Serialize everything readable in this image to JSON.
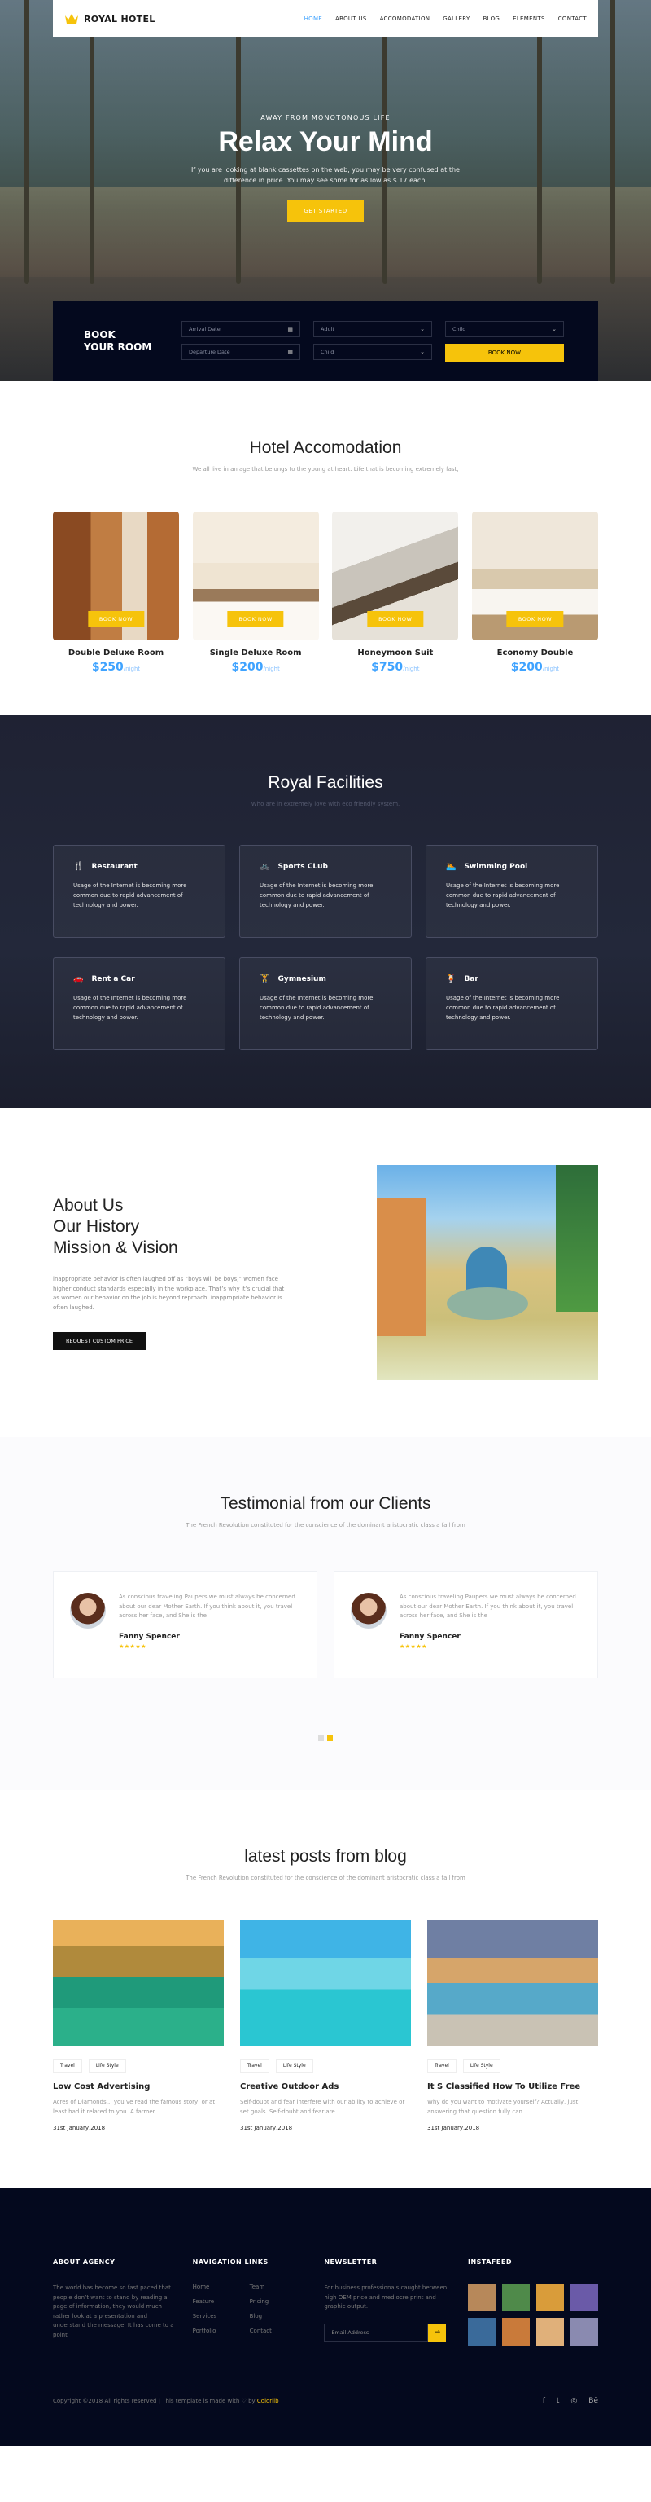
{
  "header": {
    "brand": "ROYAL HOTEL",
    "menu": [
      "HOME",
      "ABOUT US",
      "ACCOMODATION",
      "GALLERY",
      "BLOG",
      "ELEMENTS",
      "CONTACT"
    ]
  },
  "hero": {
    "kicker": "AWAY FROM MONOTONOUS LIFE",
    "title": "Relax Your Mind",
    "text": "If you are looking at blank cassettes on the web, you may be very confused at the difference in price. You may see some for as low as $.17 each.",
    "cta": "GET STARTED"
  },
  "booking": {
    "title_line1": "BOOK",
    "title_line2": "YOUR ROOM",
    "arrival": "Arrival Date",
    "departure": "Departure Date",
    "adult": "Adult",
    "child1": "Child",
    "child2": "Child",
    "submit": "BOOK NOW"
  },
  "accomodation": {
    "title": "Hotel Accomodation",
    "subtitle": "We all live in an age that belongs to the young at heart. Life that is becoming extremely fast,",
    "book_label": "BOOK NOW",
    "per": "/night",
    "rooms": [
      {
        "name": "Double Deluxe Room",
        "price": "$250"
      },
      {
        "name": "Single Deluxe Room",
        "price": "$200"
      },
      {
        "name": "Honeymoon Suit",
        "price": "$750"
      },
      {
        "name": "Economy Double",
        "price": "$200"
      }
    ]
  },
  "facilities": {
    "title": "Royal Facilities",
    "subtitle": "Who are in extremely love with eco friendly system.",
    "items": [
      {
        "icon": "fork-knife-icon",
        "glyph": "🍴",
        "name": "Restaurant",
        "text": "Usage of the Internet is becoming more common due to rapid advancement of technology and power."
      },
      {
        "icon": "bicycle-icon",
        "glyph": "🚲",
        "name": "Sports CLub",
        "text": "Usage of the Internet is becoming more common due to rapid advancement of technology and power."
      },
      {
        "icon": "pool-icon",
        "glyph": "🏊",
        "name": "Swimming Pool",
        "text": "Usage of the Internet is becoming more common due to rapid advancement of technology and power."
      },
      {
        "icon": "car-icon",
        "glyph": "🚗",
        "name": "Rent a Car",
        "text": "Usage of the Internet is becoming more common due to rapid advancement of technology and power."
      },
      {
        "icon": "dumbbell-icon",
        "glyph": "🏋",
        "name": "Gymnesium",
        "text": "Usage of the Internet is becoming more common due to rapid advancement of technology and power."
      },
      {
        "icon": "drink-icon",
        "glyph": "🍹",
        "name": "Bar",
        "text": "Usage of the Internet is becoming more common due to rapid advancement of technology and power."
      }
    ]
  },
  "about": {
    "line1": "About Us",
    "line2": "Our History",
    "line3": "Mission & Vision",
    "text": "inappropriate behavior is often laughed off as “boys will be boys,” women face higher conduct standards especially in the workplace. That’s why it’s crucial that as women our behavior on the job is beyond reproach. inappropriate behavior is often laughed.",
    "cta": "REQUEST CUSTOM PRICE"
  },
  "testimonial": {
    "title": "Testimonial from our Clients",
    "subtitle": "The French Revolution constituted for the conscience of the dominant aristocratic class a fall from",
    "items": [
      {
        "text": "As conscious traveling Paupers we must always be concerned about our dear Mother Earth. If you think about it, you travel across her face, and She is the",
        "name": "Fanny Spencer",
        "stars": "★★★★★"
      },
      {
        "text": "As conscious traveling Paupers we must always be concerned about our dear Mother Earth. If you think about it, you travel across her face, and She is the",
        "name": "Fanny Spencer",
        "stars": "★★★★★"
      }
    ]
  },
  "blog": {
    "title": "latest posts from blog",
    "subtitle": "The French Revolution constituted for the conscience of the dominant aristocratic class a fall from",
    "posts": [
      {
        "t1": "Travel",
        "t2": "Life Style",
        "title": "Low Cost Advertising",
        "text": "Acres of Diamonds… you’ve read the famous story, or at least had it related to you. A farmer.",
        "date": "31st January,2018"
      },
      {
        "t1": "Travel",
        "t2": "Life Style",
        "title": "Creative Outdoor Ads",
        "text": "Self-doubt and fear interfere with our ability to achieve or set goals. Self-doubt and fear are",
        "date": "31st January,2018"
      },
      {
        "t1": "Travel",
        "t2": "Life Style",
        "title": "It S Classified How To Utilize Free",
        "text": "Why do you want to motivate yourself? Actually, just answering that question fully can",
        "date": "31st January,2018"
      }
    ]
  },
  "footer": {
    "about_title": "ABOUT AGENCY",
    "about_text": "The world has become so fast paced that people don’t want to stand by reading a page of information, they would much rather look at a presentation and understand the message. It has come to a point",
    "nav_title": "NAVIGATION LINKS",
    "nav_links": [
      "Home",
      "Team",
      "Feature",
      "Pricing",
      "Services",
      "Blog",
      "Portfolio",
      "Contact"
    ],
    "news_title": "NEWSLETTER",
    "news_text": "For business professionals caught between high OEM price and mediocre print and graphic output.",
    "email_ph": "Email Address",
    "insta_title": "INSTAFEED",
    "copyright": "Copyright ©2018 All rights reserved | This template is made with ♡ by",
    "credit": "Colorlib",
    "social": [
      "f",
      "t",
      "◎",
      "Bē"
    ]
  },
  "colors": {
    "accent": "#f6c30b",
    "link": "#3fa3ff",
    "dark": "#04091e"
  }
}
